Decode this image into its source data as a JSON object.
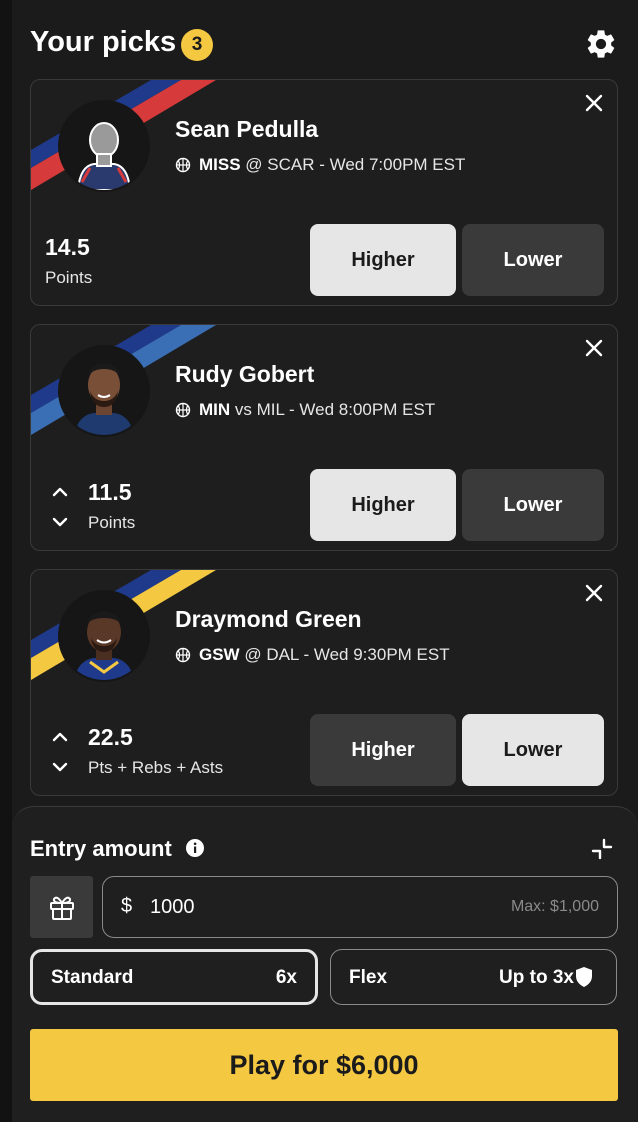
{
  "header": {
    "title": "Your picks",
    "count": "3",
    "settings_icon": "gear-icon"
  },
  "picks": [
    {
      "player": "Sean Pedulla",
      "team": "MISS",
      "matchup": " @ SCAR - Wed 7:00PM EST",
      "line": "14.5",
      "stat": "Points",
      "higher_label": "Higher",
      "lower_label": "Lower",
      "selected": "higher",
      "stripe_color": "#d63a3a",
      "stripe_color2": "#1f3a8a"
    },
    {
      "player": "Rudy Gobert",
      "team": "MIN",
      "matchup": " vs MIL - Wed 8:00PM EST",
      "line": "11.5",
      "stat": "Points",
      "higher_label": "Higher",
      "lower_label": "Lower",
      "selected": "higher",
      "stripe_color": "#3a6fb5",
      "stripe_color2": "#1f3a8a"
    },
    {
      "player": "Draymond Green",
      "team": "GSW",
      "matchup": " @ DAL - Wed 9:30PM EST",
      "line": "22.5",
      "stat": "Pts + Rebs + Asts",
      "higher_label": "Higher",
      "lower_label": "Lower",
      "selected": "lower",
      "stripe_color": "#f5c842",
      "stripe_color2": "#1f3a8a"
    }
  ],
  "entry": {
    "title": "Entry amount",
    "currency": "$",
    "amount": "1000",
    "max_label": "Max: $1,000",
    "standard_label": "Standard",
    "standard_mult": "6x",
    "flex_label": "Flex",
    "flex_mult": "Up to 3x",
    "play_label": "Play for $6,000"
  },
  "colors": {
    "accent": "#f5c842",
    "background": "#1b1b1b",
    "button_dark": "#3a3a3a",
    "button_light": "#e6e6e6"
  }
}
